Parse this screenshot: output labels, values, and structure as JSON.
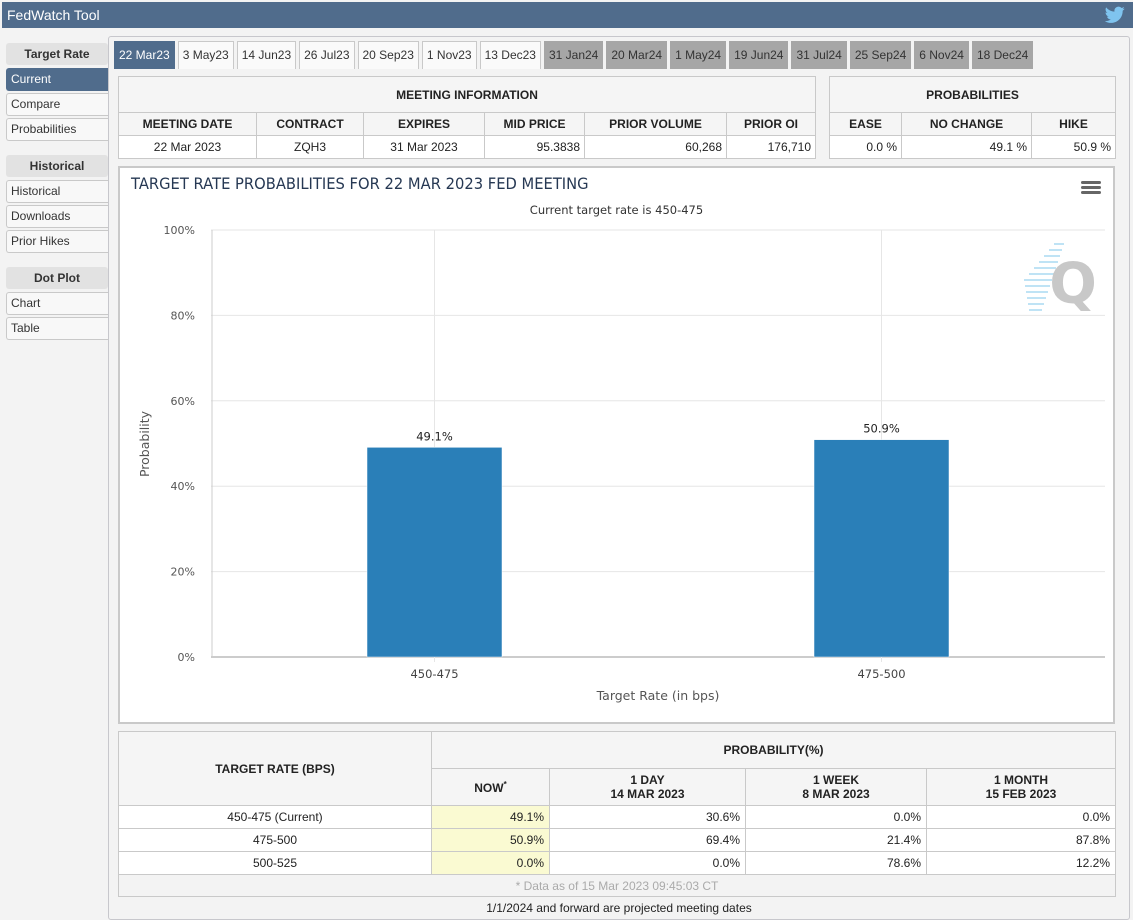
{
  "app": {
    "title": "FedWatch Tool",
    "share_icon": "twitter-icon"
  },
  "sidebar": {
    "sections": [
      {
        "heading": "Target Rate",
        "items": [
          {
            "label": "Current",
            "active": true
          },
          {
            "label": "Compare"
          },
          {
            "label": "Probabilities"
          }
        ]
      },
      {
        "heading": "Historical",
        "items": [
          {
            "label": "Historical"
          },
          {
            "label": "Downloads"
          },
          {
            "label": "Prior Hikes"
          }
        ]
      },
      {
        "heading": "Dot Plot",
        "items": [
          {
            "label": "Chart"
          },
          {
            "label": "Table"
          }
        ]
      }
    ]
  },
  "tabs": [
    {
      "label": "22 Mar23",
      "state": "active"
    },
    {
      "label": "3 May23",
      "state": "normal"
    },
    {
      "label": "14 Jun23",
      "state": "normal"
    },
    {
      "label": "26 Jul23",
      "state": "normal"
    },
    {
      "label": "20 Sep23",
      "state": "normal"
    },
    {
      "label": "1 Nov23",
      "state": "normal"
    },
    {
      "label": "13 Dec23",
      "state": "normal"
    },
    {
      "label": "31 Jan24",
      "state": "future"
    },
    {
      "label": "20 Mar24",
      "state": "future"
    },
    {
      "label": "1 May24",
      "state": "future"
    },
    {
      "label": "19 Jun24",
      "state": "future"
    },
    {
      "label": "31 Jul24",
      "state": "future"
    },
    {
      "label": "25 Sep24",
      "state": "future"
    },
    {
      "label": "6 Nov24",
      "state": "future"
    },
    {
      "label": "18 Dec24",
      "state": "future"
    }
  ],
  "meeting_info": {
    "title": "MEETING INFORMATION",
    "headers": [
      "MEETING DATE",
      "CONTRACT",
      "EXPIRES",
      "MID PRICE",
      "PRIOR VOLUME",
      "PRIOR OI"
    ],
    "values": [
      "22 Mar 2023",
      "ZQH3",
      "31 Mar 2023",
      "95.3838",
      "60,268",
      "176,710"
    ]
  },
  "probabilities": {
    "title": "PROBABILITIES",
    "headers": [
      "EASE",
      "NO CHANGE",
      "HIKE"
    ],
    "values": [
      "0.0 %",
      "49.1 %",
      "50.9 %"
    ]
  },
  "chart_data": {
    "type": "bar",
    "title": "TARGET RATE PROBABILITIES FOR 22 MAR 2023 FED MEETING",
    "subtitle": "Current target rate is 450-475",
    "xlabel": "Target Rate (in bps)",
    "ylabel": "Probability",
    "categories": [
      "450-475",
      "475-500"
    ],
    "values": [
      49.1,
      50.9
    ],
    "data_labels": [
      "49.1%",
      "50.9%"
    ],
    "ylim": [
      0,
      100
    ],
    "yticks": [
      0,
      20,
      40,
      60,
      80,
      100
    ],
    "ytick_labels": [
      "0%",
      "20%",
      "40%",
      "60%",
      "80%",
      "100%"
    ],
    "grid": true,
    "bar_color": "#2a7fb8",
    "watermark": "Q"
  },
  "history_table": {
    "col_target": "TARGET RATE (BPS)",
    "group_header": "PROBABILITY(%)",
    "columns": [
      {
        "line1": "NOW",
        "line2": "",
        "star": "*"
      },
      {
        "line1": "1 DAY",
        "line2": "14 MAR 2023"
      },
      {
        "line1": "1 WEEK",
        "line2": "8 MAR 2023"
      },
      {
        "line1": "1 MONTH",
        "line2": "15 FEB 2023"
      }
    ],
    "rows": [
      {
        "rate": "450-475 (Current)",
        "values": [
          "49.1%",
          "30.6%",
          "0.0%",
          "0.0%"
        ]
      },
      {
        "rate": "475-500",
        "values": [
          "50.9%",
          "69.4%",
          "21.4%",
          "87.8%"
        ]
      },
      {
        "rate": "500-525",
        "values": [
          "0.0%",
          "0.0%",
          "78.6%",
          "12.2%"
        ]
      }
    ],
    "footer": "* Data as of 15 Mar 2023 09:45:03 CT"
  },
  "footnote": "1/1/2024 and forward are projected meeting dates"
}
